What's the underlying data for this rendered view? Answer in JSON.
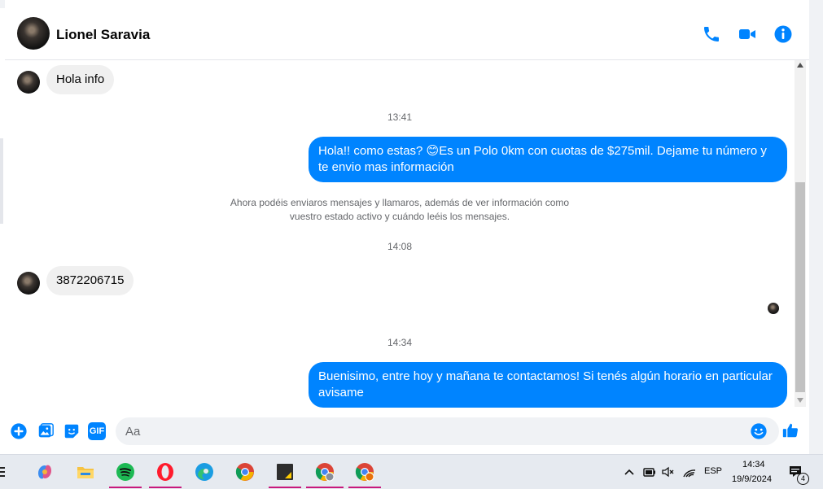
{
  "colors": {
    "accent": "#0084ff",
    "incoming_bubble": "#f0f0f0",
    "muted_text": "#65676b"
  },
  "header": {
    "contact_name": "Lionel Saravia",
    "icons": [
      "phone-icon",
      "video-camera-icon",
      "info-icon"
    ]
  },
  "messages": [
    {
      "direction": "incoming",
      "text": "Hola info"
    },
    {
      "type": "timestamp",
      "text": "13:41"
    },
    {
      "direction": "outgoing",
      "text": "Hola!! como estas? 😊Es un Polo 0km con cuotas de $275mil. Dejame tu número y te envio mas información"
    },
    {
      "type": "notice",
      "text": "Ahora podéis enviaros mensajes y llamaros, además de ver información como vuestro estado activo y cuándo leéis los mensajes."
    },
    {
      "type": "timestamp",
      "text": "14:08"
    },
    {
      "direction": "incoming",
      "text": "3872206715"
    },
    {
      "type": "timestamp",
      "text": "14:34"
    },
    {
      "direction": "outgoing",
      "text": "Buenisimo, entre hoy y mañana te contactamos! Si tenés algún horario en particular avisame"
    }
  ],
  "composer": {
    "placeholder": "Aa",
    "gif_label": "GIF",
    "icons": [
      "plus-circle-icon",
      "image-icon",
      "sticker-icon",
      "gif-icon",
      "emoji-icon",
      "thumbs-up-icon"
    ]
  },
  "taskbar": {
    "apps": [
      "copilot-icon",
      "file-explorer-icon",
      "spotify-icon",
      "opera-icon",
      "edge-icon",
      "chrome-icon",
      "sticky-notes-icon",
      "chrome-profile-icon",
      "chrome-profile-2-icon"
    ],
    "language": "ESP",
    "time": "14:34",
    "date": "19/9/2024",
    "notification_count": "4"
  }
}
